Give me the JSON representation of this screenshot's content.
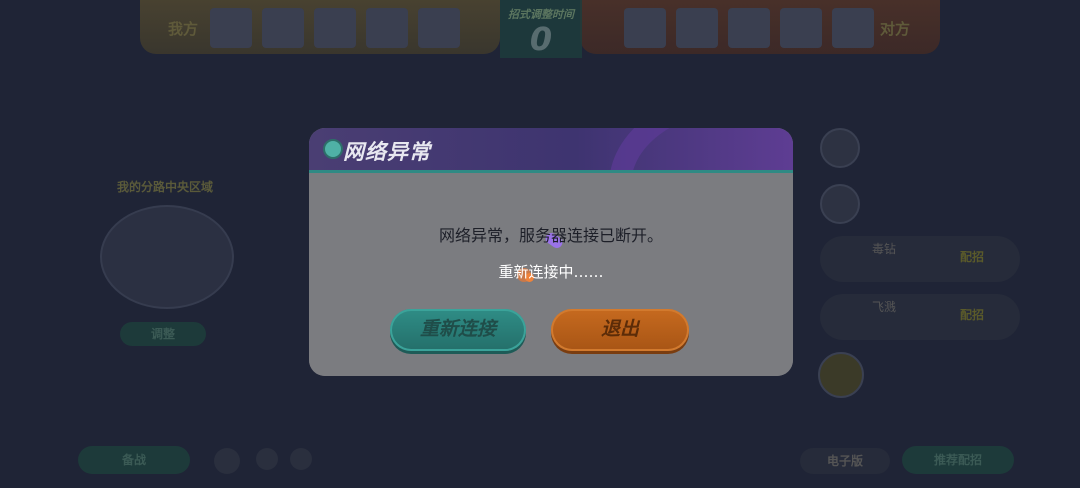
{
  "background": {
    "my_side_label": "我方",
    "enemy_side_label": "对方",
    "score_title": "招式调整时间",
    "score_value": "0",
    "minimap_title": "我的分路中央区域",
    "minimap_button": "调整",
    "bottom_left_button": "备战",
    "bottom_right_buttons": [
      "电子版",
      "推荐配招"
    ],
    "skill_rows": [
      {
        "name": "毒钻",
        "tag": "配招"
      },
      {
        "name": "飞溅",
        "tag": "配招"
      }
    ]
  },
  "dialog": {
    "title": "网络异常",
    "message": "网络异常，服务器连接已断开。",
    "status": "重新连接中……",
    "reconnect_label": "重新连接",
    "exit_label": "退出"
  },
  "colors": {
    "header_purple": "#4a3e73",
    "accent_teal": "#2f8d86",
    "accent_orange": "#c66a1f"
  }
}
